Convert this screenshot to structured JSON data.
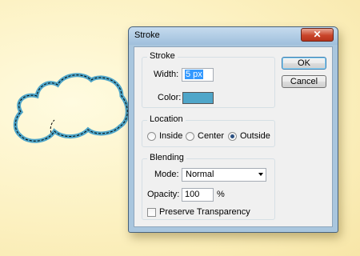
{
  "colors": {
    "stroke_color": "#4fa6c9",
    "canvas_background": "#fcf1c1",
    "close_button": "#c9452a"
  },
  "dialog": {
    "title": "Stroke",
    "close_icon": "close-icon",
    "stroke_group": {
      "legend": "Stroke",
      "width_label": "Width:",
      "width_value": "5 px",
      "color_label": "Color:"
    },
    "location_group": {
      "legend": "Location",
      "options": [
        "Inside",
        "Center",
        "Outside"
      ],
      "selected": "Outside"
    },
    "blending_group": {
      "legend": "Blending",
      "mode_label": "Mode:",
      "mode_value": "Normal",
      "opacity_label": "Opacity:",
      "opacity_value": "100",
      "opacity_unit": "%",
      "preserve_label": "Preserve Transparency",
      "preserve_checked": false
    },
    "buttons": {
      "ok": "OK",
      "cancel": "Cancel"
    }
  }
}
